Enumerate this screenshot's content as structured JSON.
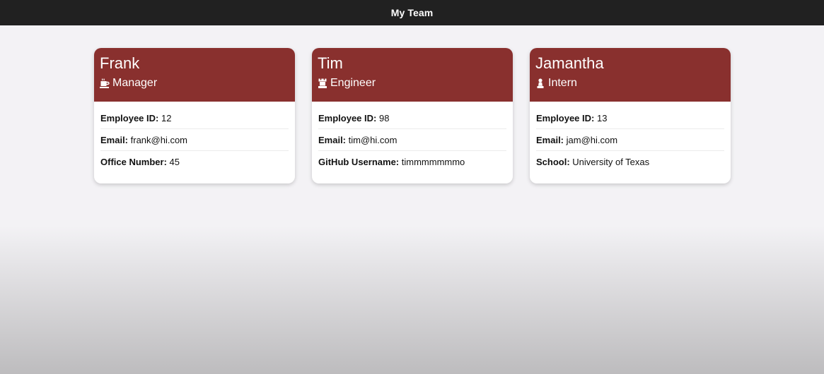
{
  "header": {
    "title": "My Team"
  },
  "colors": {
    "card_header": "#89302e",
    "topbar": "#212121"
  },
  "cards": [
    {
      "name": "Frank",
      "role": "Manager",
      "role_icon": "mug-icon",
      "rows": [
        {
          "label": "Employee ID:",
          "value": "12"
        },
        {
          "label": "Email:",
          "value": "frank@hi.com"
        },
        {
          "label": "Office Number:",
          "value": "45"
        }
      ]
    },
    {
      "name": "Tim",
      "role": "Engineer",
      "role_icon": "chess-rook-icon",
      "rows": [
        {
          "label": "Employee ID:",
          "value": "98"
        },
        {
          "label": "Email:",
          "value": "tim@hi.com"
        },
        {
          "label": "GitHub Username:",
          "value": "timmmmmmmo"
        }
      ]
    },
    {
      "name": "Jamantha",
      "role": "Intern",
      "role_icon": "chess-pawn-icon",
      "rows": [
        {
          "label": "Employee ID:",
          "value": "13"
        },
        {
          "label": "Email:",
          "value": "jam@hi.com"
        },
        {
          "label": "School:",
          "value": "University of Texas"
        }
      ]
    }
  ]
}
